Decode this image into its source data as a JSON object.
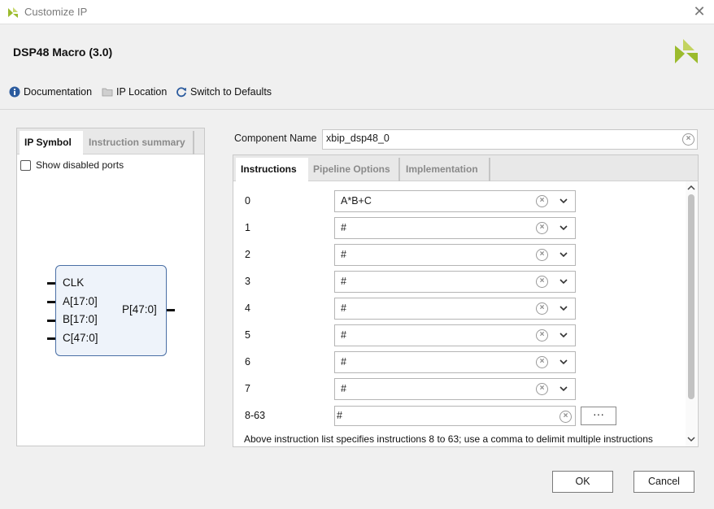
{
  "window": {
    "title": "Customize IP"
  },
  "header": {
    "title": "DSP48 Macro (3.0)"
  },
  "toolbar": {
    "documentation": "Documentation",
    "ip_location": "IP Location",
    "switch_defaults": "Switch to Defaults"
  },
  "left_panel": {
    "tabs": [
      "IP Symbol",
      "Instruction summary"
    ],
    "show_disabled_ports": "Show disabled ports",
    "symbol": {
      "inputs": [
        "CLK",
        "A[17:0]",
        "B[17:0]",
        "C[47:0]"
      ],
      "output": "P[47:0]"
    }
  },
  "component": {
    "label": "Component Name",
    "value": "xbip_dsp48_0"
  },
  "right_panel": {
    "tabs": [
      "Instructions",
      "Pipeline Options",
      "Implementation"
    ],
    "instructions": [
      {
        "label": "0",
        "value": "A*B+C"
      },
      {
        "label": "1",
        "value": "#"
      },
      {
        "label": "2",
        "value": "#"
      },
      {
        "label": "3",
        "value": "#"
      },
      {
        "label": "4",
        "value": "#"
      },
      {
        "label": "5",
        "value": "#"
      },
      {
        "label": "6",
        "value": "#"
      },
      {
        "label": "7",
        "value": "#"
      }
    ],
    "extra": {
      "label": "8-63",
      "value": "#",
      "button": "···"
    },
    "note": "Above instruction list specifies instructions 8 to 63; use a comma to delimit multiple instructions"
  },
  "buttons": {
    "ok": "OK",
    "cancel": "Cancel"
  },
  "colors": {
    "accent": "#4a6fa5",
    "logo_green": "#9bbb2d",
    "logo_dark": "#6a8a1c"
  }
}
